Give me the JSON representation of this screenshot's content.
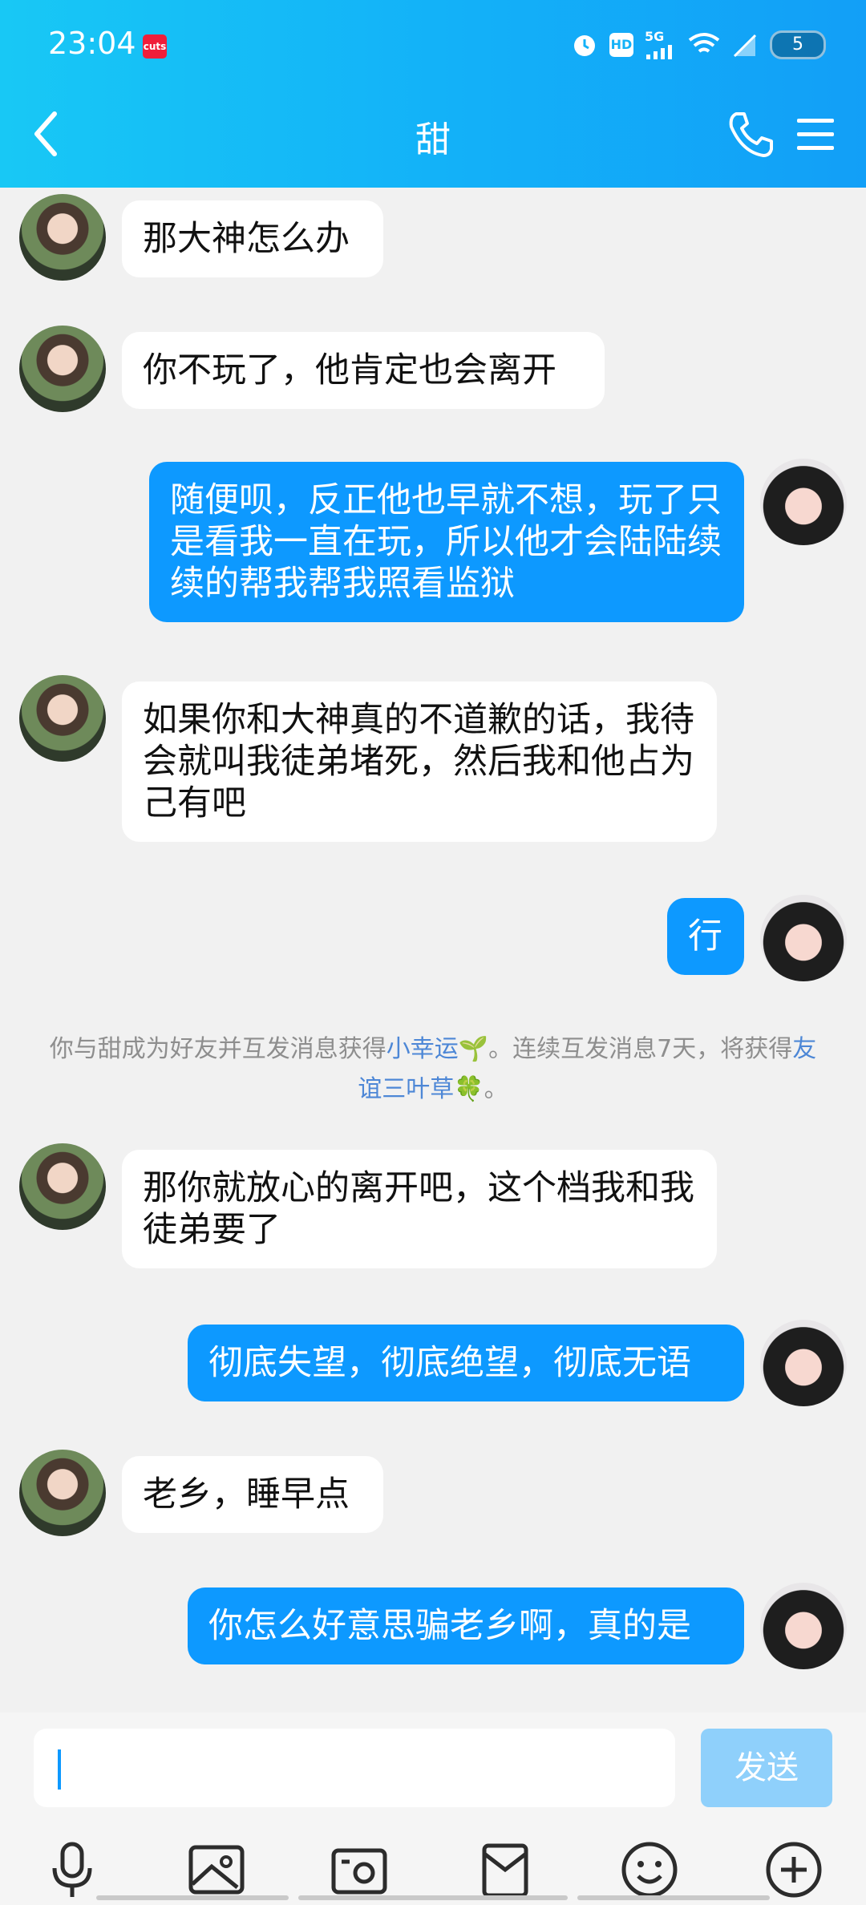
{
  "status_bar": {
    "time": "23:04",
    "app_badge": "cuts",
    "network": "5G",
    "hd": "HD",
    "battery": "5"
  },
  "header": {
    "title": "甜",
    "back_icon": "chevron-left-icon",
    "call_icon": "phone-icon",
    "menu_icon": "hamburger-menu-icon"
  },
  "messages": [
    {
      "side": "in",
      "text": "那大神怎么办"
    },
    {
      "side": "in",
      "text": "你不玩了，他肯定也会离开"
    },
    {
      "side": "out",
      "text": "随便呗，反正他也早就不想，玩了只是看我一直在玩，所以他才会陆陆续续的帮我帮我照看监狱"
    },
    {
      "side": "in",
      "text": "如果你和大神真的不道歉的话，我待会就叫我徒弟堵死，然后我和他占为己有吧"
    },
    {
      "side": "out",
      "text": "行"
    },
    {
      "side": "in",
      "text": "那你就放心的离开吧，这个档我和我徒弟要了"
    },
    {
      "side": "out",
      "text": "彻底失望，彻底绝望，彻底无语"
    },
    {
      "side": "in",
      "text": "老乡，睡早点"
    },
    {
      "side": "out",
      "text": "你怎么好意思骗老乡啊，真的是"
    }
  ],
  "system_note": {
    "part1": "你与甜成为好友并互发消息获得",
    "link1": "小幸运",
    "icon1": "🌱",
    "part2": "。连续互发消息7天，将获得",
    "link2": "友谊三叶草",
    "icon2": "🍀",
    "part3": "。"
  },
  "input": {
    "placeholder": "",
    "send_label": "发送"
  },
  "toolbar": [
    "microphone-icon",
    "image-icon",
    "camera-icon",
    "red-packet-icon",
    "emoji-icon",
    "plus-icon"
  ]
}
